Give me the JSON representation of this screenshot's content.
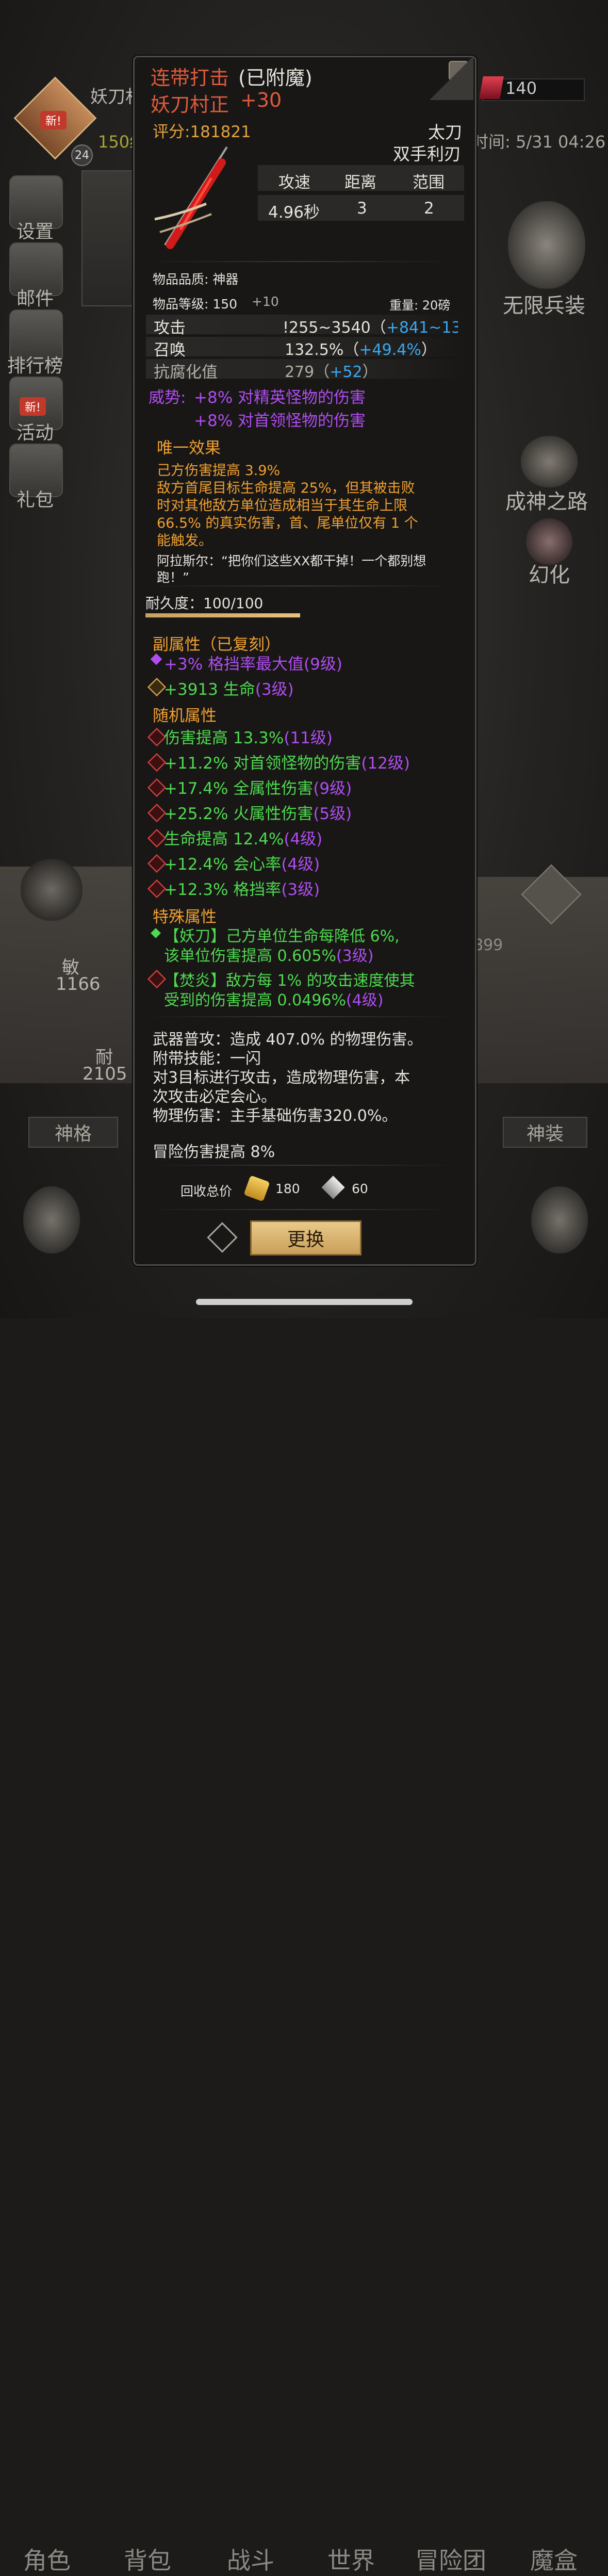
{
  "bg": {
    "char_name": "妖刀村",
    "level_badge": "24",
    "level_text": "150级",
    "new_badge": "新!",
    "currency": "140",
    "time_text": "时间: 5/31 04:26",
    "sidebar": [
      {
        "label": "设置"
      },
      {
        "label": "邮件"
      },
      {
        "label": "排行榜"
      },
      {
        "label": "活动",
        "badge": "新!"
      },
      {
        "label": "礼包"
      }
    ],
    "right": {
      "infinite_weapon": "无限兵装",
      "god_path": "成神之路",
      "illusion": "幻化"
    },
    "stats": {
      "agi_label": "敏",
      "agi_value": "1166",
      "end_label": "耐",
      "end_value": "2105",
      "partial_value": "899"
    },
    "tabs": {
      "left": "神格",
      "right": "神装"
    },
    "nav": [
      "角色",
      "背包",
      "战斗",
      "世界",
      "冒险团",
      "魔盒"
    ]
  },
  "item": {
    "name": "连带打击",
    "enchant": "(已附魔)",
    "weapon": "妖刀村正",
    "plus": "+30",
    "score": "评分:181821",
    "type": "太刀",
    "subtype": "双手利刃",
    "stats_header": [
      "攻速",
      "距离",
      "范围"
    ],
    "stats_values": [
      "4.96秒",
      "3",
      "2"
    ],
    "quality": "物品品质: 神器",
    "item_level_label": "物品等级: 150",
    "item_level_plus": "+10",
    "weight": "重量: 20磅",
    "attrs": [
      {
        "label": "攻击",
        "value": "!255~3540（",
        "bonus": "+841~13",
        "tail": ""
      },
      {
        "label": "召唤",
        "value": "132.5%（",
        "bonus": "+49.4%",
        "tail": "）"
      },
      {
        "label": "抗腐化值",
        "value": "279（",
        "bonus": "+52",
        "tail": "）"
      }
    ],
    "majesty_label": "威势:",
    "majesty": [
      "+8% 对精英怪物的伤害",
      "+8% 对首领怪物的伤害"
    ],
    "unique_title": "唯一效果",
    "unique_lines": [
      "己方伤害提高 3.9%",
      "敌方首尾目标生命提高 25%，但其被击败",
      "时对其他敌方单位造成相当于其生命上限",
      "66.5% 的真实伤害，首、尾单位仅有 1 个",
      "能触发。"
    ],
    "quote_lines": [
      "阿拉斯尔：“把你们这些XX都干掉！一个都别想",
      "跑！”"
    ],
    "durability": "耐久度：100/100",
    "sub_title": "副属性（已复刻）",
    "sub_attrs": [
      {
        "text": "+3% 格挡率最大值",
        "lv": "(9级)",
        "color": "purple"
      },
      {
        "text": "+3913 生命",
        "lv": "(3级)",
        "color": "green"
      }
    ],
    "random_title": "随机属性",
    "random_attrs": [
      {
        "text": "伤害提高 13.3%",
        "lv": "(11级)"
      },
      {
        "text": "+11.2% 对首领怪物的伤害",
        "lv": "(12级)"
      },
      {
        "text": "+17.4% 全属性伤害",
        "lv": "(9级)"
      },
      {
        "text": "+25.2% 火属性伤害",
        "lv": "(5级)"
      },
      {
        "text": "生命提高 12.4%",
        "lv": "(4级)"
      },
      {
        "text": "+12.4% 会心率",
        "lv": "(4级)"
      },
      {
        "text": "+12.3% 格挡率",
        "lv": "(3级)"
      }
    ],
    "special_title": "特殊属性",
    "special_attrs": [
      {
        "line1": "【妖刀】己方单位生命每降低 6%,",
        "line2": "该单位伤害提高 0.605%",
        "lv": "(3级)"
      },
      {
        "line1": "【焚炎】敌方每 1% 的攻击速度使其",
        "line2": "受到的伤害提高 0.0496%",
        "lv": "(4级)"
      }
    ],
    "skill_lines": [
      "武器普攻：造成 407.0% 的物理伤害。",
      "附带技能：一闪",
      "对3目标进行攻击，造成物理伤害，本",
      "次攻击必定会心。",
      "物理伤害：主手基础伤害320.0%。"
    ],
    "adventure": "冒险伤害提高 8%",
    "recycle_label": "回收总价",
    "recycle_gold": "180",
    "recycle_shard": "60",
    "replace_button": "更换"
  },
  "colors": {
    "panel_bg": "#181716",
    "name": "#e05a3c",
    "gold": "#e4a33a",
    "purple": "#b04cf0",
    "blue": "#3aa8ef",
    "green": "#4fd94f"
  }
}
